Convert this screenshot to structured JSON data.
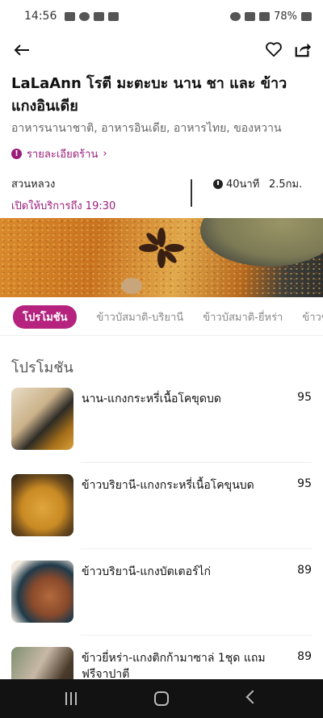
{
  "status_bar": {
    "time": "14:56",
    "battery": "78%"
  },
  "restaurant": {
    "name": "LaLaAnn โรตี มะตะบะ นาน ชา และ ข้าวแกงอินเดีย",
    "cuisines": "อาหารนานาชาติ, อาหารอินเดีย, อาหารไทย, ของหวาน",
    "details_link": "รายละเอียดร้าน",
    "location": "สวนหลวง",
    "open_hours": "เปิดให้บริการถึง 19:30",
    "eta": "40นาที",
    "distance": "2.5กม."
  },
  "tabs": [
    {
      "label": "โปรโมชัน",
      "active": true
    },
    {
      "label": "ข้าวบัสมาติ-บริยานี",
      "active": false
    },
    {
      "label": "ข้าวบัสมาติ-ยี่หร่า",
      "active": false
    },
    {
      "label": "ข้าวข",
      "active": false
    }
  ],
  "section": {
    "title": "โปรโมชัน"
  },
  "menu_items": [
    {
      "name": "นาน-แกงกระหรี่เนื้อโคขุดบด",
      "price": "95"
    },
    {
      "name": "ข้าวบริยานี-แกงกระหรี่เนื้อโคขุนบด",
      "price": "95"
    },
    {
      "name": "ข้าวบริยานี-แกงบัตเตอร์ไก่",
      "price": "89"
    },
    {
      "name": "ข้าวยี่หร่า-แกงติกก้ามาซาล่ 1ชุด แถมฟรีจาปาตี",
      "price": "89"
    }
  ],
  "colors": {
    "accent": "#9b1d7a",
    "tab_active": "#b5237f"
  }
}
